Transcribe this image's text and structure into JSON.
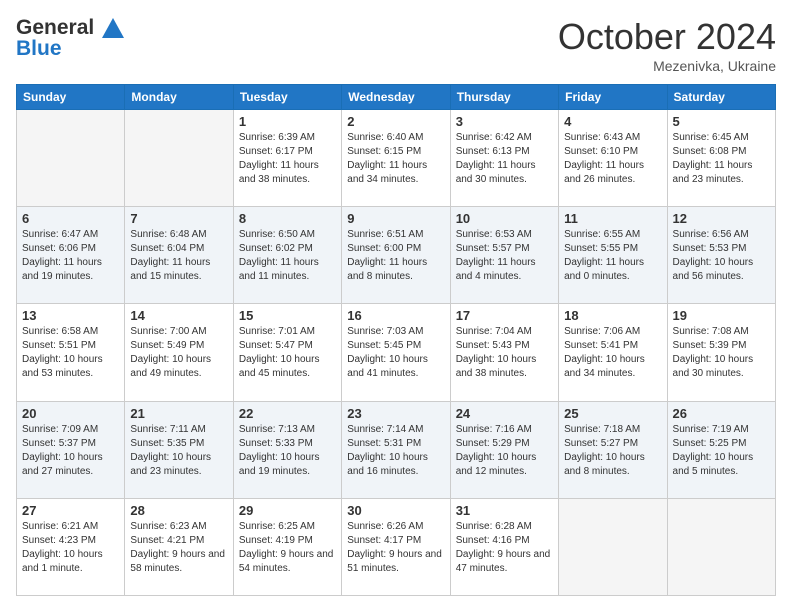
{
  "header": {
    "logo_line1": "General",
    "logo_line2": "Blue",
    "month": "October 2024",
    "location": "Mezenivka, Ukraine"
  },
  "days_of_week": [
    "Sunday",
    "Monday",
    "Tuesday",
    "Wednesday",
    "Thursday",
    "Friday",
    "Saturday"
  ],
  "weeks": [
    [
      {
        "day": "",
        "info": ""
      },
      {
        "day": "",
        "info": ""
      },
      {
        "day": "1",
        "info": "Sunrise: 6:39 AM\nSunset: 6:17 PM\nDaylight: 11 hours and 38 minutes."
      },
      {
        "day": "2",
        "info": "Sunrise: 6:40 AM\nSunset: 6:15 PM\nDaylight: 11 hours and 34 minutes."
      },
      {
        "day": "3",
        "info": "Sunrise: 6:42 AM\nSunset: 6:13 PM\nDaylight: 11 hours and 30 minutes."
      },
      {
        "day": "4",
        "info": "Sunrise: 6:43 AM\nSunset: 6:10 PM\nDaylight: 11 hours and 26 minutes."
      },
      {
        "day": "5",
        "info": "Sunrise: 6:45 AM\nSunset: 6:08 PM\nDaylight: 11 hours and 23 minutes."
      }
    ],
    [
      {
        "day": "6",
        "info": "Sunrise: 6:47 AM\nSunset: 6:06 PM\nDaylight: 11 hours and 19 minutes."
      },
      {
        "day": "7",
        "info": "Sunrise: 6:48 AM\nSunset: 6:04 PM\nDaylight: 11 hours and 15 minutes."
      },
      {
        "day": "8",
        "info": "Sunrise: 6:50 AM\nSunset: 6:02 PM\nDaylight: 11 hours and 11 minutes."
      },
      {
        "day": "9",
        "info": "Sunrise: 6:51 AM\nSunset: 6:00 PM\nDaylight: 11 hours and 8 minutes."
      },
      {
        "day": "10",
        "info": "Sunrise: 6:53 AM\nSunset: 5:57 PM\nDaylight: 11 hours and 4 minutes."
      },
      {
        "day": "11",
        "info": "Sunrise: 6:55 AM\nSunset: 5:55 PM\nDaylight: 11 hours and 0 minutes."
      },
      {
        "day": "12",
        "info": "Sunrise: 6:56 AM\nSunset: 5:53 PM\nDaylight: 10 hours and 56 minutes."
      }
    ],
    [
      {
        "day": "13",
        "info": "Sunrise: 6:58 AM\nSunset: 5:51 PM\nDaylight: 10 hours and 53 minutes."
      },
      {
        "day": "14",
        "info": "Sunrise: 7:00 AM\nSunset: 5:49 PM\nDaylight: 10 hours and 49 minutes."
      },
      {
        "day": "15",
        "info": "Sunrise: 7:01 AM\nSunset: 5:47 PM\nDaylight: 10 hours and 45 minutes."
      },
      {
        "day": "16",
        "info": "Sunrise: 7:03 AM\nSunset: 5:45 PM\nDaylight: 10 hours and 41 minutes."
      },
      {
        "day": "17",
        "info": "Sunrise: 7:04 AM\nSunset: 5:43 PM\nDaylight: 10 hours and 38 minutes."
      },
      {
        "day": "18",
        "info": "Sunrise: 7:06 AM\nSunset: 5:41 PM\nDaylight: 10 hours and 34 minutes."
      },
      {
        "day": "19",
        "info": "Sunrise: 7:08 AM\nSunset: 5:39 PM\nDaylight: 10 hours and 30 minutes."
      }
    ],
    [
      {
        "day": "20",
        "info": "Sunrise: 7:09 AM\nSunset: 5:37 PM\nDaylight: 10 hours and 27 minutes."
      },
      {
        "day": "21",
        "info": "Sunrise: 7:11 AM\nSunset: 5:35 PM\nDaylight: 10 hours and 23 minutes."
      },
      {
        "day": "22",
        "info": "Sunrise: 7:13 AM\nSunset: 5:33 PM\nDaylight: 10 hours and 19 minutes."
      },
      {
        "day": "23",
        "info": "Sunrise: 7:14 AM\nSunset: 5:31 PM\nDaylight: 10 hours and 16 minutes."
      },
      {
        "day": "24",
        "info": "Sunrise: 7:16 AM\nSunset: 5:29 PM\nDaylight: 10 hours and 12 minutes."
      },
      {
        "day": "25",
        "info": "Sunrise: 7:18 AM\nSunset: 5:27 PM\nDaylight: 10 hours and 8 minutes."
      },
      {
        "day": "26",
        "info": "Sunrise: 7:19 AM\nSunset: 5:25 PM\nDaylight: 10 hours and 5 minutes."
      }
    ],
    [
      {
        "day": "27",
        "info": "Sunrise: 6:21 AM\nSunset: 4:23 PM\nDaylight: 10 hours and 1 minute."
      },
      {
        "day": "28",
        "info": "Sunrise: 6:23 AM\nSunset: 4:21 PM\nDaylight: 9 hours and 58 minutes."
      },
      {
        "day": "29",
        "info": "Sunrise: 6:25 AM\nSunset: 4:19 PM\nDaylight: 9 hours and 54 minutes."
      },
      {
        "day": "30",
        "info": "Sunrise: 6:26 AM\nSunset: 4:17 PM\nDaylight: 9 hours and 51 minutes."
      },
      {
        "day": "31",
        "info": "Sunrise: 6:28 AM\nSunset: 4:16 PM\nDaylight: 9 hours and 47 minutes."
      },
      {
        "day": "",
        "info": ""
      },
      {
        "day": "",
        "info": ""
      }
    ]
  ]
}
